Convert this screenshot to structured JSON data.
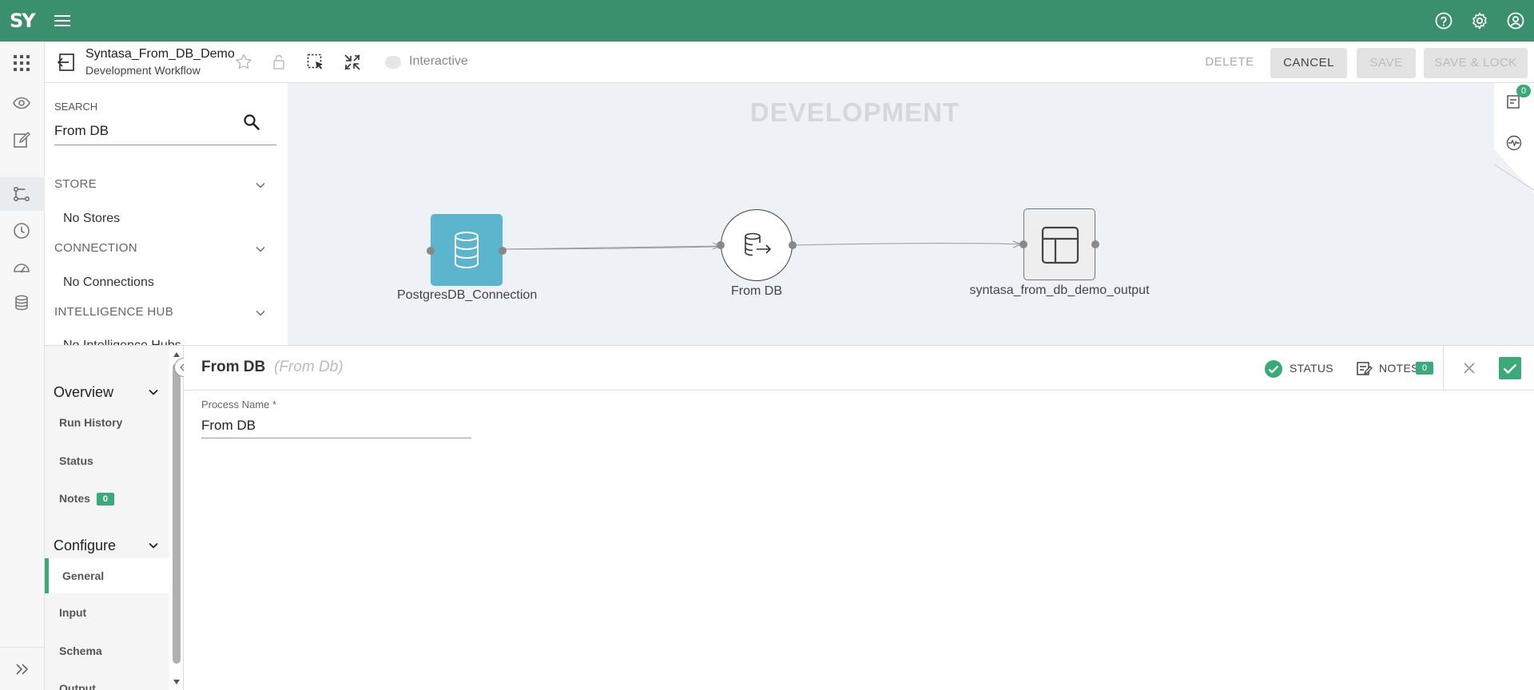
{
  "app": {
    "logo_text": "SY",
    "brand_color": "#3a8f6c",
    "accent_color": "#3aaa78"
  },
  "workflow": {
    "title": "Syntasa_From_DB_Demo",
    "subtitle": "Development Workflow",
    "interactive_label": "Interactive",
    "delete_label": "DELETE",
    "cancel_label": "CANCEL",
    "save_label": "SAVE",
    "save_lock_label": "SAVE & LOCK"
  },
  "search": {
    "label": "SEARCH",
    "value": "From DB",
    "categories": [
      {
        "label": "STORE",
        "empty": "No Stores"
      },
      {
        "label": "CONNECTION",
        "empty": "No Connections"
      },
      {
        "label": "INTELLIGENCE HUB",
        "empty": "No Intelligence Hubs"
      }
    ]
  },
  "canvas": {
    "environment_label": "DEVELOPMENT",
    "notes_count": "0",
    "nodes": [
      {
        "label": "PostgresDB_Connection",
        "icon": "database-icon"
      },
      {
        "label": "From DB",
        "icon": "database-export-icon"
      },
      {
        "label": "syntasa_from_db_demo_output",
        "icon": "table-layout-icon"
      }
    ]
  },
  "panel": {
    "process_title": "From DB",
    "process_type": "(From Db)",
    "status_label": "STATUS",
    "notes_label": "NOTES",
    "notes_count": "0",
    "field_label": "Process Name *",
    "field_value": "From DB",
    "nav": {
      "overview_label": "Overview",
      "overview_items": [
        {
          "label": "Run History"
        },
        {
          "label": "Status"
        },
        {
          "label": "Notes",
          "badge": "0"
        }
      ],
      "configure_label": "Configure",
      "configure_items": [
        {
          "label": "General"
        },
        {
          "label": "Input"
        },
        {
          "label": "Schema"
        },
        {
          "label": "Output"
        }
      ]
    }
  }
}
